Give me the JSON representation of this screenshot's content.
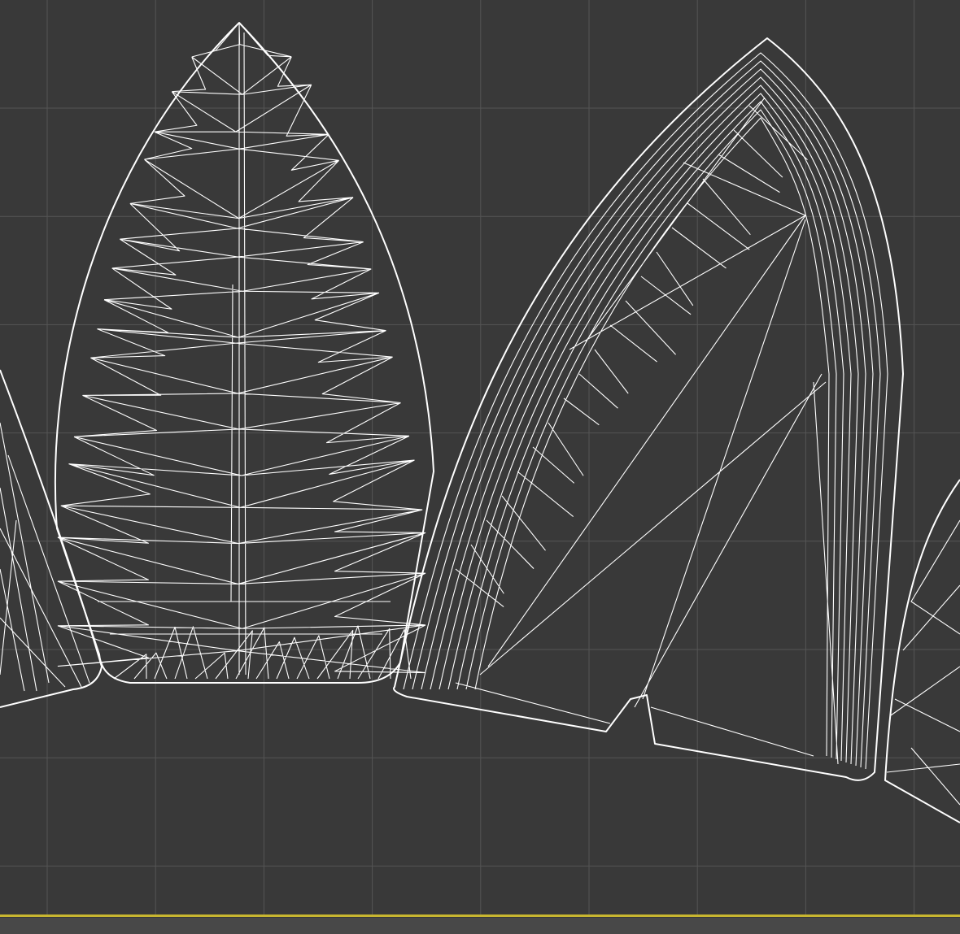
{
  "viewport": {
    "mode": "wireframe",
    "colors": {
      "background": "#393939",
      "grid": "#555555",
      "wire": "#ffffff",
      "active_border": "#c8b630",
      "status_bar": "#484848"
    },
    "objects": [
      "left-partial-mesh",
      "pointed-mesh",
      "arch-mesh",
      "right-partial-mesh"
    ]
  }
}
